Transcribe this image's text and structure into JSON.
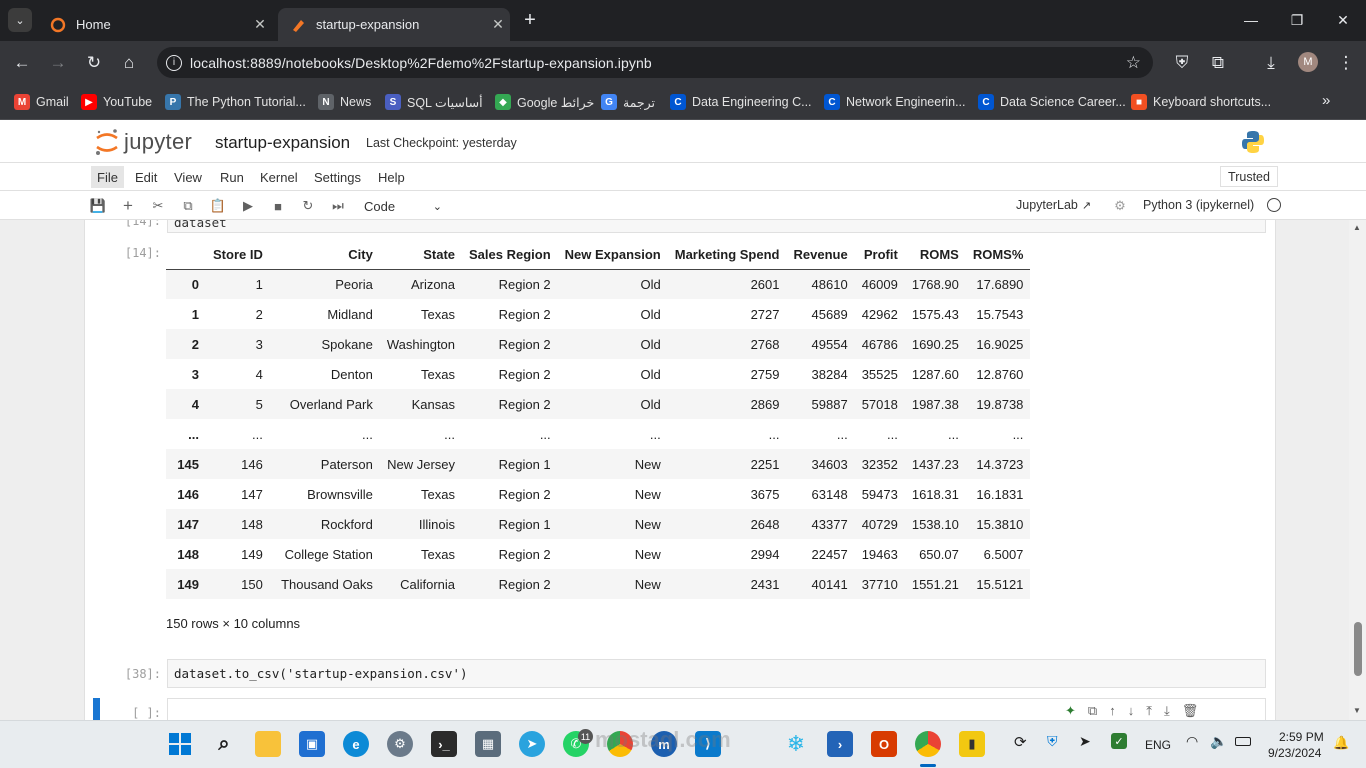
{
  "browser": {
    "tabs": [
      {
        "title": "Home",
        "active": false
      },
      {
        "title": "startup-expansion",
        "active": true
      }
    ],
    "new_tab": "+",
    "url": "localhost:8889/notebooks/Desktop%2Fdemo%2Fstartup-expansion.ipynb",
    "bookmarks": [
      {
        "label": "Gmail",
        "icon": "gmail-icon",
        "color": "#ea4335",
        "glyph": "M"
      },
      {
        "label": "YouTube",
        "icon": "youtube-icon",
        "color": "#ff0000",
        "glyph": "▶"
      },
      {
        "label": "The Python Tutorial...",
        "icon": "python-icon",
        "color": "#3776ab",
        "glyph": "P"
      },
      {
        "label": "News",
        "icon": "news-icon",
        "color": "#5f6368",
        "glyph": "N"
      },
      {
        "label": "SQL أساسيات",
        "icon": "sql-icon",
        "color": "#4a5fc1",
        "glyph": "S"
      },
      {
        "label": "Google خرائط",
        "icon": "maps-icon",
        "color": "#34a853",
        "glyph": "◆"
      },
      {
        "label": "ترجمة",
        "icon": "translate-icon",
        "color": "#4285f4",
        "glyph": "G"
      },
      {
        "label": "Data Engineering C...",
        "icon": "coursera-icon",
        "color": "#0056d2",
        "glyph": "C"
      },
      {
        "label": "Network Engineerin...",
        "icon": "coursera-icon",
        "color": "#0056d2",
        "glyph": "C"
      },
      {
        "label": "Data Science Career...",
        "icon": "coursera-icon",
        "color": "#0056d2",
        "glyph": "C"
      },
      {
        "label": "Keyboard shortcuts...",
        "icon": "microsoft-icon",
        "color": "#f25022",
        "glyph": "■"
      }
    ],
    "profile_initial": "M"
  },
  "jupyter": {
    "logo_text": "jupyter",
    "notebook_name": "startup-expansion",
    "checkpoint": "Last Checkpoint: yesterday",
    "trusted": "Trusted",
    "menus": [
      "File",
      "Edit",
      "View",
      "Run",
      "Kernel",
      "Settings",
      "Help"
    ],
    "cell_type": "Code",
    "jupyterlab_link": "JupyterLab",
    "kernel": "Python 3 (ipykernel)"
  },
  "notebook": {
    "partial_code": "dataset",
    "partial_prompt": "[14]:",
    "output_prompt": "[14]:",
    "table": {
      "columns": [
        "",
        "Store ID",
        "City",
        "State",
        "Sales Region",
        "New Expansion",
        "Marketing Spend",
        "Revenue",
        "Profit",
        "ROMS",
        "ROMS%"
      ],
      "rows": [
        [
          "0",
          "1",
          "Peoria",
          "Arizona",
          "Region 2",
          "Old",
          "2601",
          "48610",
          "46009",
          "1768.90",
          "17.6890"
        ],
        [
          "1",
          "2",
          "Midland",
          "Texas",
          "Region 2",
          "Old",
          "2727",
          "45689",
          "42962",
          "1575.43",
          "15.7543"
        ],
        [
          "2",
          "3",
          "Spokane",
          "Washington",
          "Region 2",
          "Old",
          "2768",
          "49554",
          "46786",
          "1690.25",
          "16.9025"
        ],
        [
          "3",
          "4",
          "Denton",
          "Texas",
          "Region 2",
          "Old",
          "2759",
          "38284",
          "35525",
          "1287.60",
          "12.8760"
        ],
        [
          "4",
          "5",
          "Overland Park",
          "Kansas",
          "Region 2",
          "Old",
          "2869",
          "59887",
          "57018",
          "1987.38",
          "19.8738"
        ],
        [
          "...",
          "...",
          "...",
          "...",
          "...",
          "...",
          "...",
          "...",
          "...",
          "...",
          "..."
        ],
        [
          "145",
          "146",
          "Paterson",
          "New Jersey",
          "Region 1",
          "New",
          "2251",
          "34603",
          "32352",
          "1437.23",
          "14.3723"
        ],
        [
          "146",
          "147",
          "Brownsville",
          "Texas",
          "Region 2",
          "New",
          "3675",
          "63148",
          "59473",
          "1618.31",
          "16.1831"
        ],
        [
          "147",
          "148",
          "Rockford",
          "Illinois",
          "Region 1",
          "New",
          "2648",
          "43377",
          "40729",
          "1538.10",
          "15.3810"
        ],
        [
          "148",
          "149",
          "College Station",
          "Texas",
          "Region 2",
          "New",
          "2994",
          "22457",
          "19463",
          "650.07",
          "6.5007"
        ],
        [
          "149",
          "150",
          "Thousand Oaks",
          "California",
          "Region 2",
          "New",
          "2431",
          "40141",
          "37710",
          "1551.21",
          "15.5121"
        ]
      ],
      "summary": "150 rows × 10 columns"
    },
    "cell38_prompt": "[38]:",
    "cell38_code": "dataset.to_csv('startup-expansion.csv')",
    "empty_prompt": "[ ]:"
  },
  "taskbar": {
    "whatsapp_badge": "11",
    "language": "ENG",
    "time": "2:59 PM",
    "date": "9/23/2024",
    "watermark": "mostaql.com"
  },
  "colors": {
    "jupyter_orange": "#f37726",
    "chrome_dark": "#202124",
    "chrome_toolbar": "#35363a",
    "active_cell_bar": "#1976d2"
  }
}
